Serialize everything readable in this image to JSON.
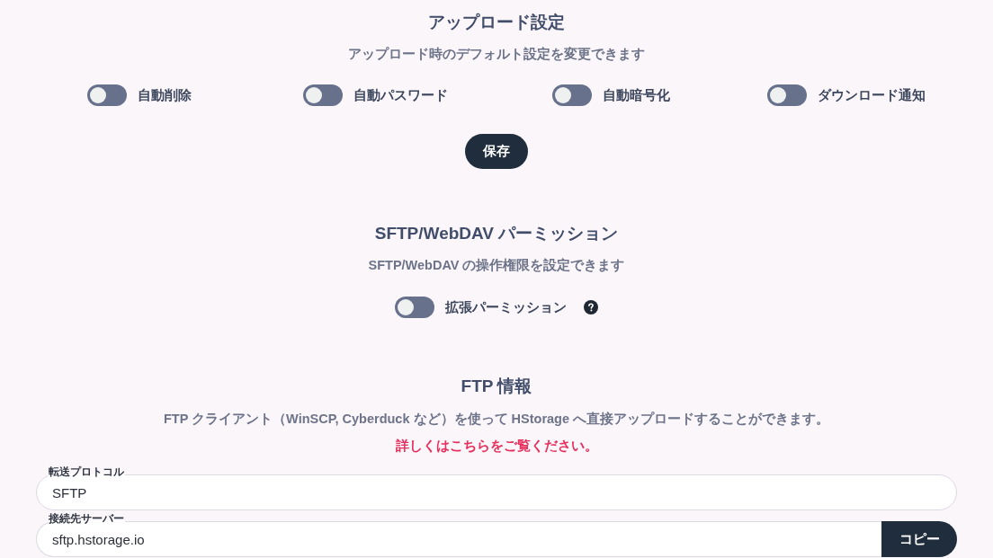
{
  "upload_settings": {
    "title": "アップロード設定",
    "subtitle": "アップロード時のデフォルト設定を変更できます",
    "toggles": [
      {
        "label": "自動削除",
        "checked": false
      },
      {
        "label": "自動パスワード",
        "checked": false
      },
      {
        "label": "自動暗号化",
        "checked": false
      },
      {
        "label": "ダウンロード通知",
        "checked": false
      }
    ],
    "save_button": "保存"
  },
  "permissions": {
    "title": "SFTP/WebDAV パーミッション",
    "subtitle": "SFTP/WebDAV の操作権限を設定できます",
    "toggles": [
      {
        "label": "拡張パーミッション",
        "checked": false,
        "help": true
      }
    ]
  },
  "ftp_info": {
    "title": "FTP 情報",
    "description": "FTP クライアント（WinSCP, Cyberduck など）を使って HStorage へ直接アップロードすることができます。",
    "link": "詳しくはこちらをご覧ください。",
    "fields": [
      {
        "label": "転送プロトコル",
        "value": "SFTP"
      },
      {
        "label": "接続先サーバー",
        "value": "sftp.hstorage.io",
        "button": "コピー"
      }
    ]
  }
}
